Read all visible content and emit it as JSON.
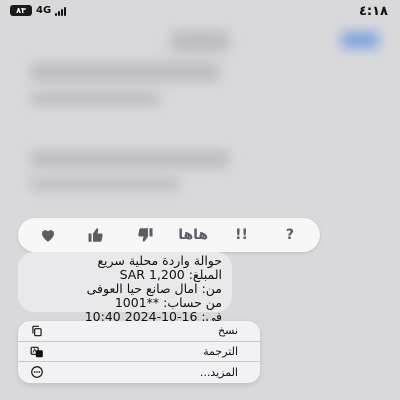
{
  "status_bar": {
    "time": "٤:١٨",
    "battery": "٨٣",
    "network": "4G"
  },
  "reactions": [
    {
      "icon": "heart-icon"
    },
    {
      "icon": "thumbs-up-icon"
    },
    {
      "icon": "thumbs-down-icon"
    },
    {
      "label": "هاها"
    },
    {
      "label": "!!"
    },
    {
      "label": "?"
    }
  ],
  "message": {
    "lines": [
      "حوالة واردة محلية سريع",
      "المبلغ: SAR 1,200",
      "من: امال صانع حيا العوفى",
      "من حساب: **1001",
      "في: 16-10-2024 10:40"
    ]
  },
  "menu": {
    "items": [
      {
        "label": "نسخ",
        "icon": "copy-icon"
      },
      {
        "label": "الترجمة",
        "icon": "translate-icon"
      },
      {
        "label": "المزيد...",
        "icon": "more-icon"
      }
    ]
  }
}
